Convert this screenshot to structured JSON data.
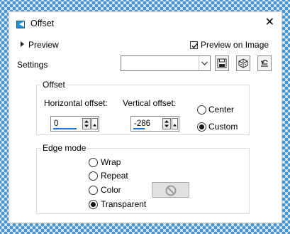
{
  "window": {
    "title": "Offset",
    "close_glyph": "✕"
  },
  "preview": {
    "label": "Preview",
    "preview_on_image_label": "Preview on Image",
    "preview_on_image_checked": true
  },
  "settings": {
    "label": "Settings",
    "selected_value": "",
    "save_icon": "floppy-disk-icon",
    "randomize_icon": "dice-icon",
    "reset_icon": "reset-icon"
  },
  "offset_group": {
    "legend": "Offset",
    "horizontal": {
      "label": "Horizontal offset:",
      "value": "0"
    },
    "vertical": {
      "label": "Vertical offset:",
      "value": "-286"
    },
    "center_label": "Center",
    "custom_label": "Custom",
    "selected": "Custom"
  },
  "edge_mode": {
    "legend": "Edge mode",
    "options": [
      "Wrap",
      "Repeat",
      "Color",
      "Transparent"
    ],
    "selected": "Transparent",
    "color_button_icon": "no-color-icon"
  },
  "colors": {
    "accent": "#1e6fd8",
    "border_dots": "#4a95d6"
  }
}
